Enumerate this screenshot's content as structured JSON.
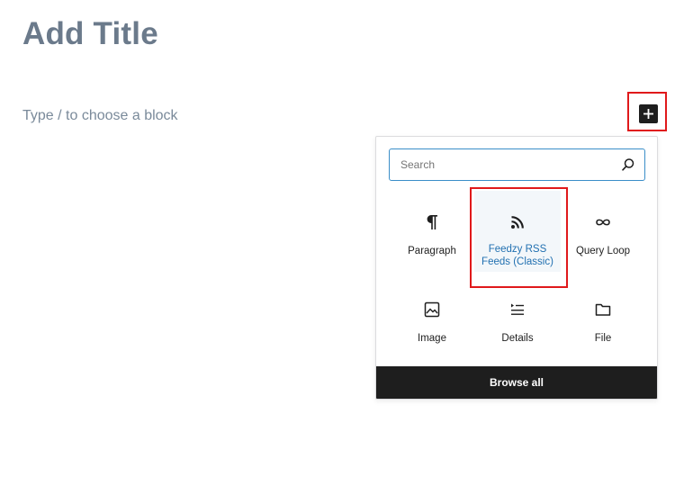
{
  "editor": {
    "title": "Add Title",
    "block_placeholder": "Type / to choose a block"
  },
  "inserter": {
    "search_placeholder": "Search",
    "blocks": [
      {
        "label": "Paragraph",
        "icon": "paragraph-icon"
      },
      {
        "label": "Feedzy RSS Feeds (Classic)",
        "icon": "rss-icon"
      },
      {
        "label": "Query Loop",
        "icon": "loop-icon"
      },
      {
        "label": "Image",
        "icon": "image-icon"
      },
      {
        "label": "Details",
        "icon": "details-icon"
      },
      {
        "label": "File",
        "icon": "folder-icon"
      }
    ],
    "browse_all": "Browse all"
  },
  "colors": {
    "highlight_outline": "#e0191b",
    "accent": "#2271b1",
    "dark": "#1e1e1e"
  }
}
